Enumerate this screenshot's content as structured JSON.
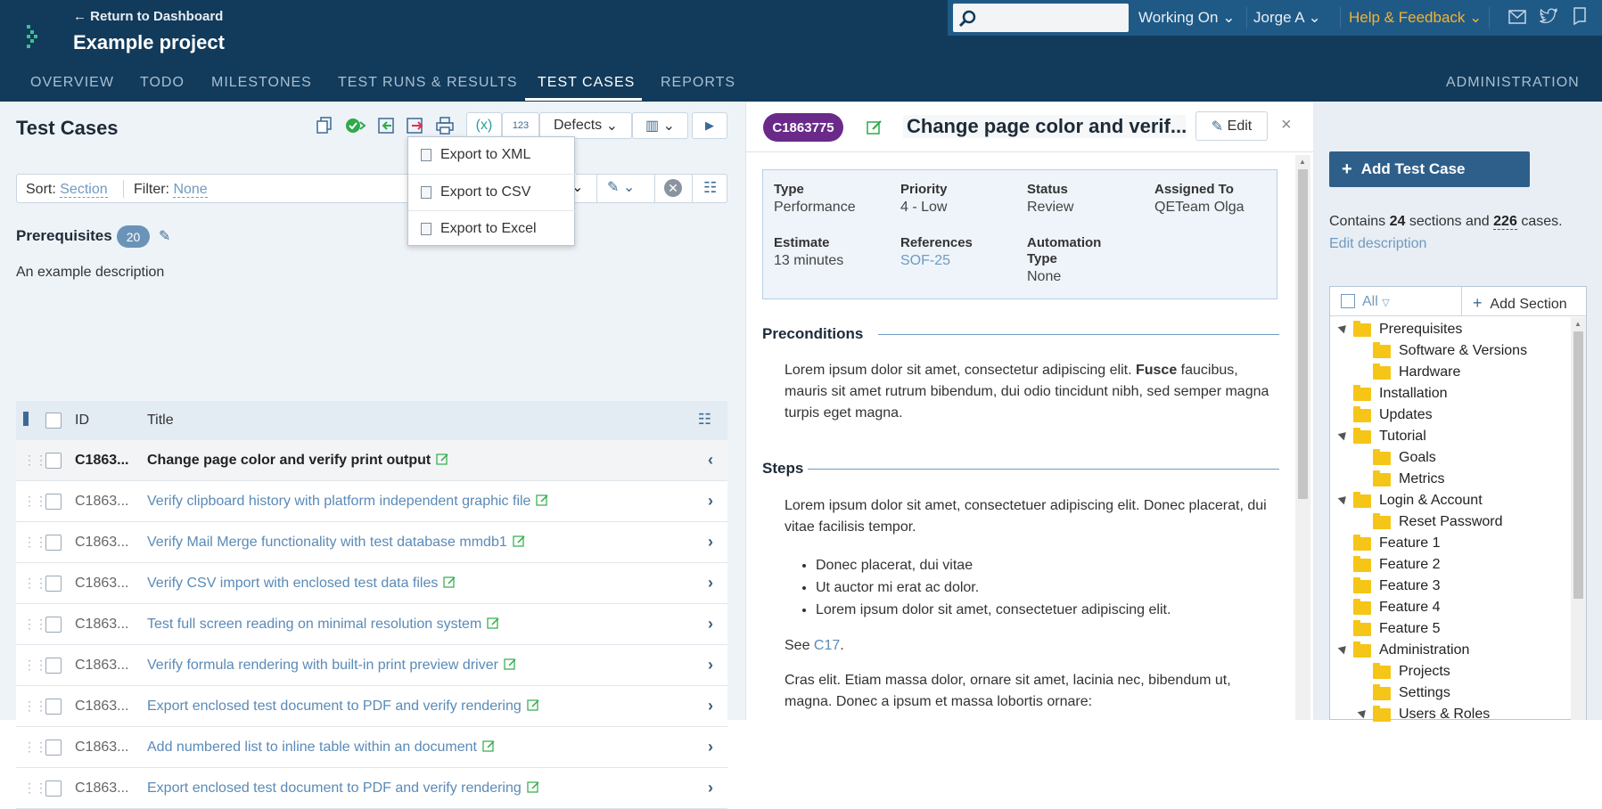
{
  "header": {
    "return_link": "← Return to Dashboard",
    "project_name": "Example project",
    "search_placeholder": "",
    "working_on": "Working On",
    "user": "Jorge A",
    "help": "Help & Feedback"
  },
  "nav": {
    "tabs": [
      "OVERVIEW",
      "TODO",
      "MILESTONES",
      "TEST RUNS & RESULTS",
      "TEST CASES",
      "REPORTS"
    ],
    "active": "TEST CASES",
    "admin": "ADMINISTRATION"
  },
  "left": {
    "title": "Test Cases",
    "defects_label": "Defects",
    "sort_label": "Sort:",
    "sort_value": "Section",
    "filter_label": "Filter:",
    "filter_value": "None",
    "export_menu": [
      "Export to XML",
      "Export to CSV",
      "Export to Excel"
    ],
    "section_name": "Prerequisites",
    "section_count": "20",
    "section_description": "An example description",
    "columns": {
      "id": "ID",
      "title": "Title"
    },
    "rows": [
      {
        "id": "C1863...",
        "title": "Change page color and verify print output"
      },
      {
        "id": "C1863...",
        "title": "Verify clipboard history with platform independent graphic file"
      },
      {
        "id": "C1863...",
        "title": "Verify Mail Merge functionality with test database mmdb1"
      },
      {
        "id": "C1863...",
        "title": "Verify CSV import with enclosed test data files"
      },
      {
        "id": "C1863...",
        "title": "Test full screen reading on minimal resolution system"
      },
      {
        "id": "C1863...",
        "title": "Verify formula rendering with built-in print preview driver"
      },
      {
        "id": "C1863...",
        "title": "Export enclosed test document to PDF and verify rendering"
      },
      {
        "id": "C1863...",
        "title": "Add numbered list to inline table within an document"
      },
      {
        "id": "C1863...",
        "title": "Export enclosed test document to PDF and verify rendering"
      }
    ]
  },
  "detail": {
    "case_id": "C1863775",
    "title": "Change page color and verif...",
    "edit_label": "Edit",
    "close": "×",
    "fields": {
      "type_label": "Type",
      "type": "Performance",
      "priority_label": "Priority",
      "priority": "4 - Low",
      "status_label": "Status",
      "status": "Review",
      "assigned_label": "Assigned To",
      "assigned": "QETeam Olga",
      "estimate_label": "Estimate",
      "estimate": "13 minutes",
      "references_label": "References",
      "references": "SOF-25",
      "automation_label_1": "Automation",
      "automation_label_2": "Type",
      "automation": "None"
    },
    "preconditions_heading": "Preconditions",
    "preconditions_text_1": "Lorem ipsum dolor sit amet, consectetur adipiscing elit.",
    "preconditions_bold": "Fusce",
    "preconditions_text_2": "faucibus, mauris sit amet rutrum bibendum, dui odio tincidunt nibh, sed semper magna turpis eget magna.",
    "steps_heading": "Steps",
    "steps_text": "Lorem ipsum dolor sit amet, consectetuer adipiscing elit. Donec placerat, dui vitae facilisis tempor.",
    "steps_list": [
      "Donec placerat, dui vitae",
      "Ut auctor mi erat ac dolor.",
      "Lorem ipsum dolor sit amet, consectetuer adipiscing elit."
    ],
    "see_text": "See",
    "see_link": "C17",
    "see_dot": ".",
    "cras_text": "Cras elit. Etiam massa dolor, ornare sit amet, lacinia nec, bibendum ut, magna. Donec a ipsum et massa lobortis ornare:"
  },
  "right": {
    "add_case": "Add Test Case",
    "contains_1": "Contains",
    "sections": "24",
    "contains_2": "sections and",
    "cases": "226",
    "contains_3": "cases.",
    "edit_description": "Edit description",
    "filter_all": "All",
    "add_section": "Add Section",
    "tree": [
      {
        "label": "Prerequisites",
        "level": 0,
        "expanded": true
      },
      {
        "label": "Software & Versions",
        "level": 1
      },
      {
        "label": "Hardware",
        "level": 1
      },
      {
        "label": "Installation",
        "level": 0
      },
      {
        "label": "Updates",
        "level": 0
      },
      {
        "label": "Tutorial",
        "level": 0,
        "expanded": true
      },
      {
        "label": "Goals",
        "level": 1
      },
      {
        "label": "Metrics",
        "level": 1
      },
      {
        "label": "Login & Account",
        "level": 0,
        "expanded": true
      },
      {
        "label": "Reset Password",
        "level": 1
      },
      {
        "label": "Feature 1",
        "level": 0
      },
      {
        "label": "Feature 2",
        "level": 0
      },
      {
        "label": "Feature 3",
        "level": 0
      },
      {
        "label": "Feature 4",
        "level": 0
      },
      {
        "label": "Feature 5",
        "level": 0
      },
      {
        "label": "Administration",
        "level": 0,
        "expanded": true
      },
      {
        "label": "Projects",
        "level": 1
      },
      {
        "label": "Settings",
        "level": 1
      },
      {
        "label": "Users & Roles",
        "level": 1,
        "expanded": true
      }
    ]
  },
  "colors": {
    "topbar": "#123a5a",
    "accent": "#2e5f8a",
    "badge": "#6a2a8a",
    "help": "#f2b233",
    "folder": "#f5c518"
  }
}
